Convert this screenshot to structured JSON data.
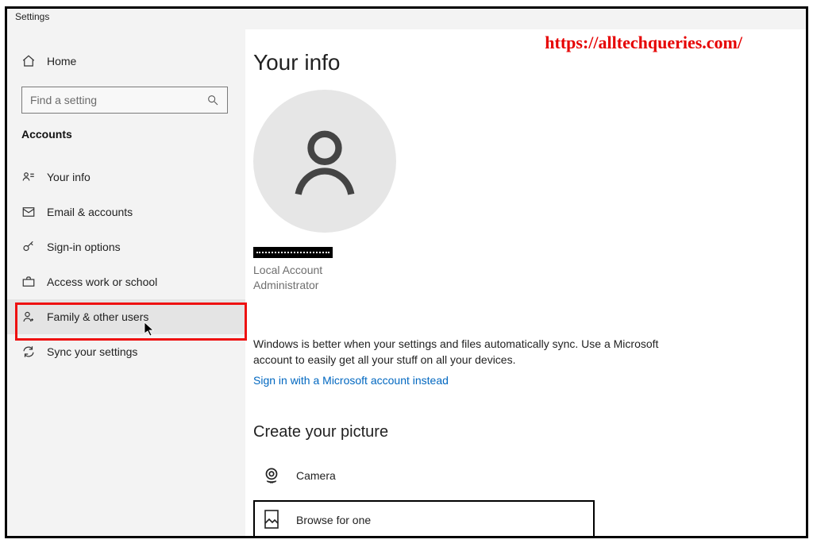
{
  "window": {
    "title": "Settings"
  },
  "watermark": "https://alltechqueries.com/",
  "sidebar": {
    "home": "Home",
    "search_placeholder": "Find a setting",
    "section": "Accounts",
    "items": [
      {
        "label": "Your info"
      },
      {
        "label": "Email & accounts"
      },
      {
        "label": "Sign-in options"
      },
      {
        "label": "Access work or school"
      },
      {
        "label": "Family & other users"
      },
      {
        "label": "Sync your settings"
      }
    ]
  },
  "main": {
    "title": "Your info",
    "account_type_line1": "Local Account",
    "account_type_line2": "Administrator",
    "sync_text": "Windows is better when your settings and files automatically sync. Use a Microsoft account to easily get all your stuff on all your devices.",
    "signin_link": "Sign in with a Microsoft account instead",
    "picture_heading": "Create your picture",
    "camera_label": "Camera",
    "browse_label": "Browse for one"
  }
}
